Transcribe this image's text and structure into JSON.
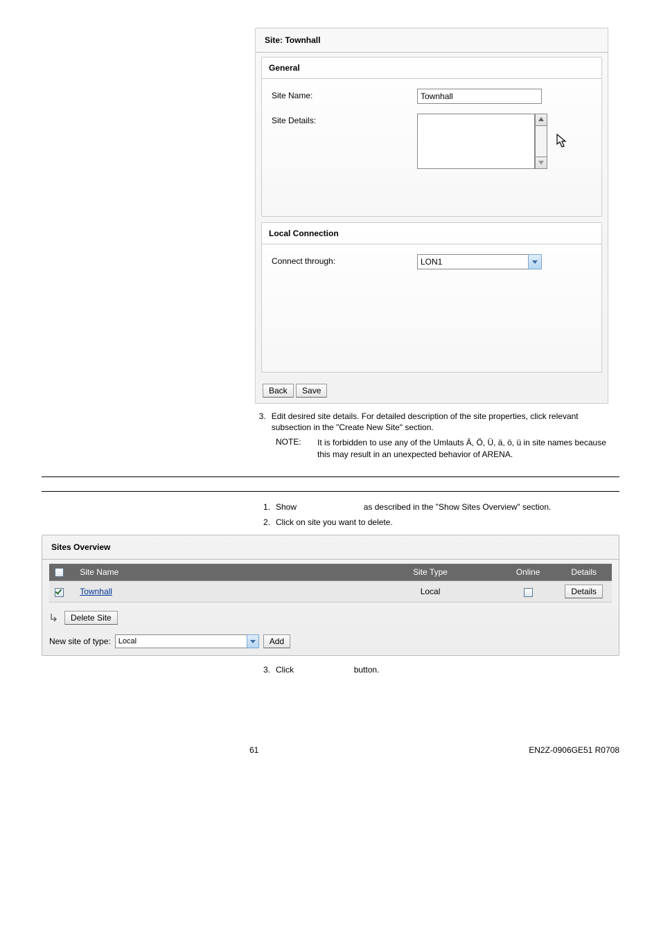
{
  "panel": {
    "title": "Site: Townhall",
    "general": {
      "heading": "General",
      "site_name_label": "Site Name:",
      "site_name_value": "Townhall",
      "site_details_label": "Site Details:",
      "site_details_value": ""
    },
    "local_connection": {
      "heading": "Local Connection",
      "connect_label": "Connect through:",
      "connect_value": "LON1"
    },
    "actions": {
      "back": "Back",
      "save": "Save"
    }
  },
  "steps_edit": {
    "num3": "3.",
    "text3": "Edit desired site details. For detailed description of the site properties, click relevant subsection in the \"Create New Site\" section.",
    "note_label": "NOTE:",
    "note_text": "It is forbidden to use any of the Umlauts Ä, Ö, Ü, ä, ö, ü  in site names because this may result in an unexpected behavior of ARENA."
  },
  "steps_delete": {
    "num1": "1.",
    "text1a": "Show",
    "text1b": "as described in the \"Show Sites Overview\" section.",
    "num2": "2.",
    "text2": "Click on site you want to delete.",
    "num3": "3.",
    "text3a": "Click",
    "text3b": "button."
  },
  "overview": {
    "title": "Sites Overview",
    "columns": {
      "name": "Site Name",
      "type": "Site Type",
      "online": "Online",
      "details": "Details"
    },
    "rows": [
      {
        "name": "Townhall",
        "type": "Local",
        "details": "Details"
      }
    ],
    "delete_btn": "Delete Site",
    "new_site_label": "New site of type:",
    "new_site_value": "Local",
    "add_btn": "Add"
  },
  "footer": {
    "page": "61",
    "doc": "EN2Z-0906GE51 R0708"
  }
}
